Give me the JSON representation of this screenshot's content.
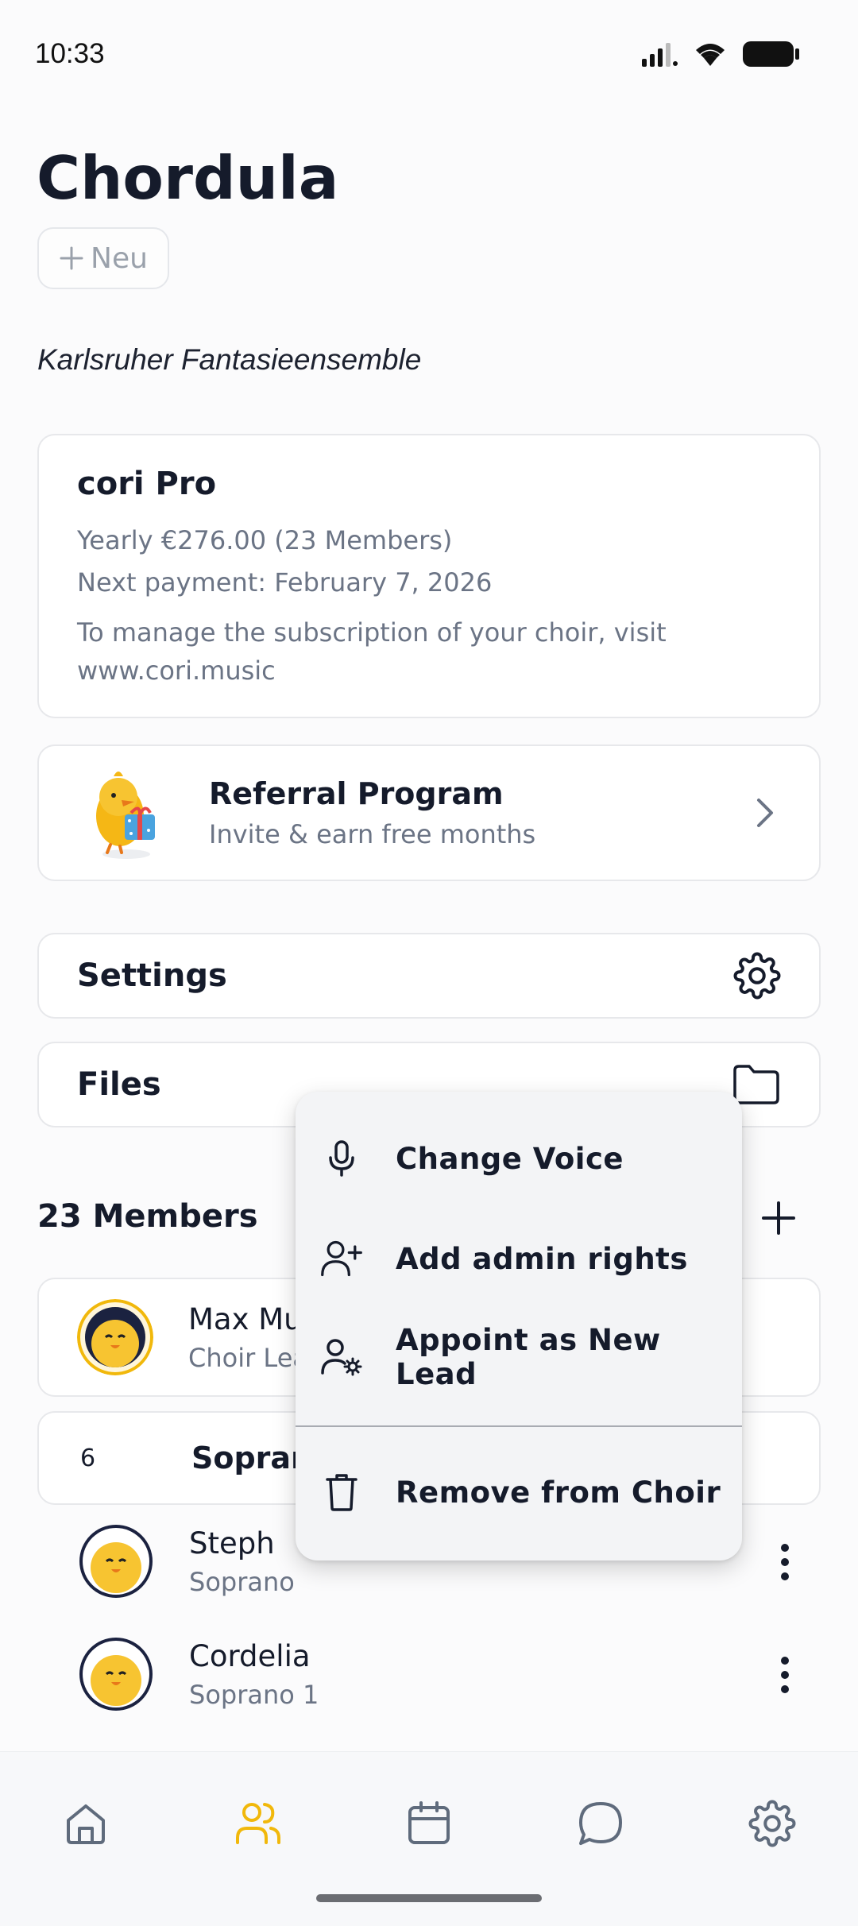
{
  "status_bar": {
    "time": "10:33"
  },
  "header": {
    "title": "Chordula",
    "new_button": "Neu",
    "choir_name": "Karlsruher Fantasieensemble"
  },
  "subscription": {
    "title": "cori Pro",
    "price_line": "Yearly €276.00 (23 Members)",
    "next_payment": "Next payment: February 7, 2026",
    "manage_line1": "To manage the subscription of your choir, visit",
    "manage_line2": "www.cori.music"
  },
  "referral": {
    "title": "Referral Program",
    "subtitle": "Invite & earn free months"
  },
  "settings_row": {
    "label": "Settings"
  },
  "files_row": {
    "label": "Files"
  },
  "members": {
    "title": "23 Members",
    "lead": {
      "name": "Max Mu",
      "role": "Choir Lea"
    },
    "group": {
      "count": "6",
      "name": "Sopran"
    },
    "list": [
      {
        "name": "Steph",
        "role": "Soprano"
      },
      {
        "name": "Cordelia",
        "role": "Soprano 1"
      }
    ]
  },
  "context_menu": {
    "items": [
      {
        "label": "Change Voice",
        "icon": "microphone-icon"
      },
      {
        "label": "Add admin rights",
        "icon": "user-plus-icon"
      },
      {
        "label": "Appoint as New Lead",
        "icon": "user-cog-icon"
      },
      {
        "label": "Remove from Choir",
        "icon": "trash-icon"
      }
    ]
  },
  "bottom_nav": {
    "items": [
      "home-icon",
      "members-icon",
      "calendar-icon",
      "chat-icon",
      "settings-icon"
    ],
    "active": "members-icon",
    "active_color": "#f1b80b",
    "inactive_color": "#5f6b7c"
  }
}
